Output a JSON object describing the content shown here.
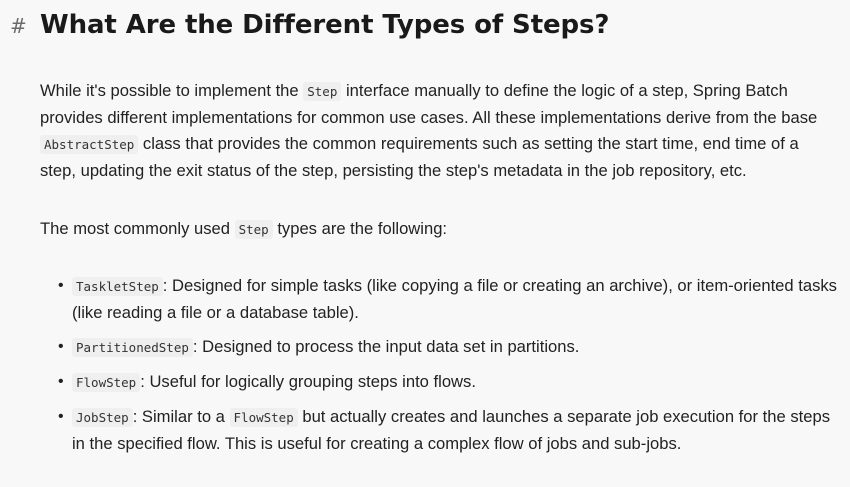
{
  "heading": {
    "anchor": "#",
    "title": "What Are the Different Types of Steps?"
  },
  "intro": {
    "t1": "While it's possible to implement the ",
    "c1": "Step",
    "t2": " interface manually to define the logic of a step, Spring Batch provides different implementations for common use cases. All these implementations derive from the base ",
    "c2": "AbstractStep",
    "t3": " class that provides the common requirements such as setting the start time, end time of a step, updating the exit status of the step, persisting the step's metadata in the job repository, etc."
  },
  "lead": {
    "t1": "The most commonly used ",
    "c1": "Step",
    "t2": " types are the following:"
  },
  "list": [
    {
      "code": "TaskletStep",
      "text": ": Designed for simple tasks (like copying a file or creating an archive), or item-oriented tasks (like reading a file or a database table)."
    },
    {
      "code": "PartitionedStep",
      "text": ": Designed to process the input data set in partitions."
    },
    {
      "code": "FlowStep",
      "text": ": Useful for logically grouping steps into flows."
    },
    {
      "code": "JobStep",
      "text": ": Similar to a ",
      "code2": "FlowStep",
      "text2": " but actually creates and launches a separate job execution for the steps in the specified flow. This is useful for creating a complex flow of jobs and sub-jobs."
    }
  ],
  "bullet_char": "•"
}
